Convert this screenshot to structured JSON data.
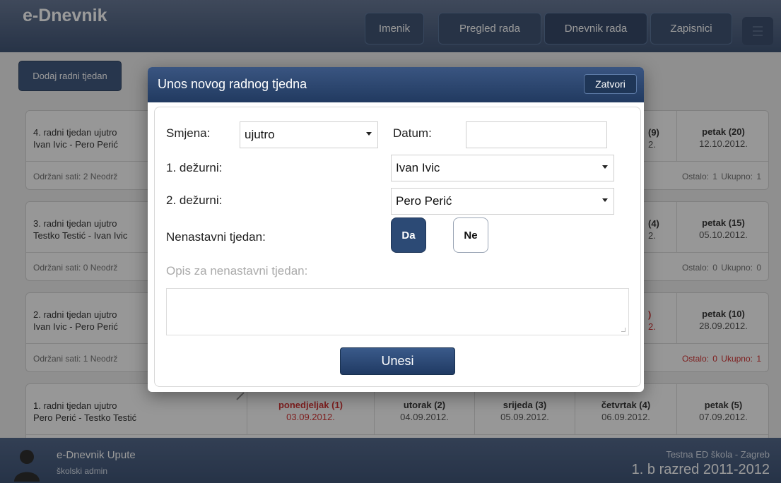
{
  "app": {
    "title": "e-Dnevnik"
  },
  "nav": [
    "Imenik",
    "Pregled rada",
    "Dnevnik rada",
    "Zapisnici"
  ],
  "main": {
    "add_week_label": "Dodaj radni tjedan"
  },
  "weeks": [
    {
      "title_line1": "4. radni tjedan ujutro",
      "title_line2": "Ivan Ivic - Pero Perić",
      "stats_left": "Održani sati: 2   Neodrž",
      "stats_right": "Ostalo: 1   Ukupno: 1",
      "partial_line1": "(9)",
      "partial_line2": "2.",
      "friday_name": "petak (20)",
      "friday_date": "12.10.2012."
    },
    {
      "title_line1": "3. radni tjedan ujutro",
      "title_line2": "Testko Testić - Ivan Ivic",
      "stats_left": "Održani sati: 0   Neodrž",
      "stats_right": "Ostalo: 0   Ukupno: 0",
      "partial_line1": "(4)",
      "partial_line2": "2.",
      "friday_name": "petak (15)",
      "friday_date": "05.10.2012."
    },
    {
      "title_line1": "2. radni tjedan ujutro",
      "title_line2": "Ivan Ivic - Pero Perić",
      "stats_left": "Održani sati: 1   Neodrž",
      "stats_right": "Ostalo: 0   Ukupno: 1",
      "partial_line1": ")",
      "partial_line2": "2.",
      "friday_name": "petak (10)",
      "friday_date": "28.09.2012."
    },
    {
      "title_line1": "1. radni tjedan ujutro",
      "title_line2": "Pero Perić - Testko Testić",
      "days": [
        {
          "name": "ponedjeljak (1)",
          "date": "03.09.2012."
        },
        {
          "name": "utorak (2)",
          "date": "04.09.2012."
        },
        {
          "name": "srijeda (3)",
          "date": "05.09.2012."
        },
        {
          "name": "četvrtak (4)",
          "date": "06.09.2012."
        },
        {
          "name": "petak (5)",
          "date": "07.09.2012."
        }
      ]
    }
  ],
  "modal": {
    "title": "Unos novog radnog tjedna",
    "close_label": "Zatvori",
    "smjena_label": "Smjena:",
    "smjena_value": "ujutro",
    "datum_label": "Datum:",
    "datum_value": "",
    "dezurni1_label": "1. dežurni:",
    "dezurni1_value": "Ivan Ivic",
    "dezurni2_label": "2. dežurni:",
    "dezurni2_value": "Pero Perić",
    "nenastavni_label": "Nenastavni tjedan:",
    "yes_label": "Da",
    "no_label": "Ne",
    "opis_label": "Opis za nenastavni tjedan:",
    "submit_label": "Unesi"
  },
  "footer": {
    "help_title": "e-Dnevnik Upute",
    "user_role": "školski admin",
    "school": "Testna ED škola - Zagreb",
    "class_year": "1. b razred 2011-2012"
  },
  "colors": {
    "primary": "#2e4a73",
    "alert_red": "#cc1f1f",
    "header_top": "#5a6c8c",
    "header_bottom": "#2e4468"
  }
}
